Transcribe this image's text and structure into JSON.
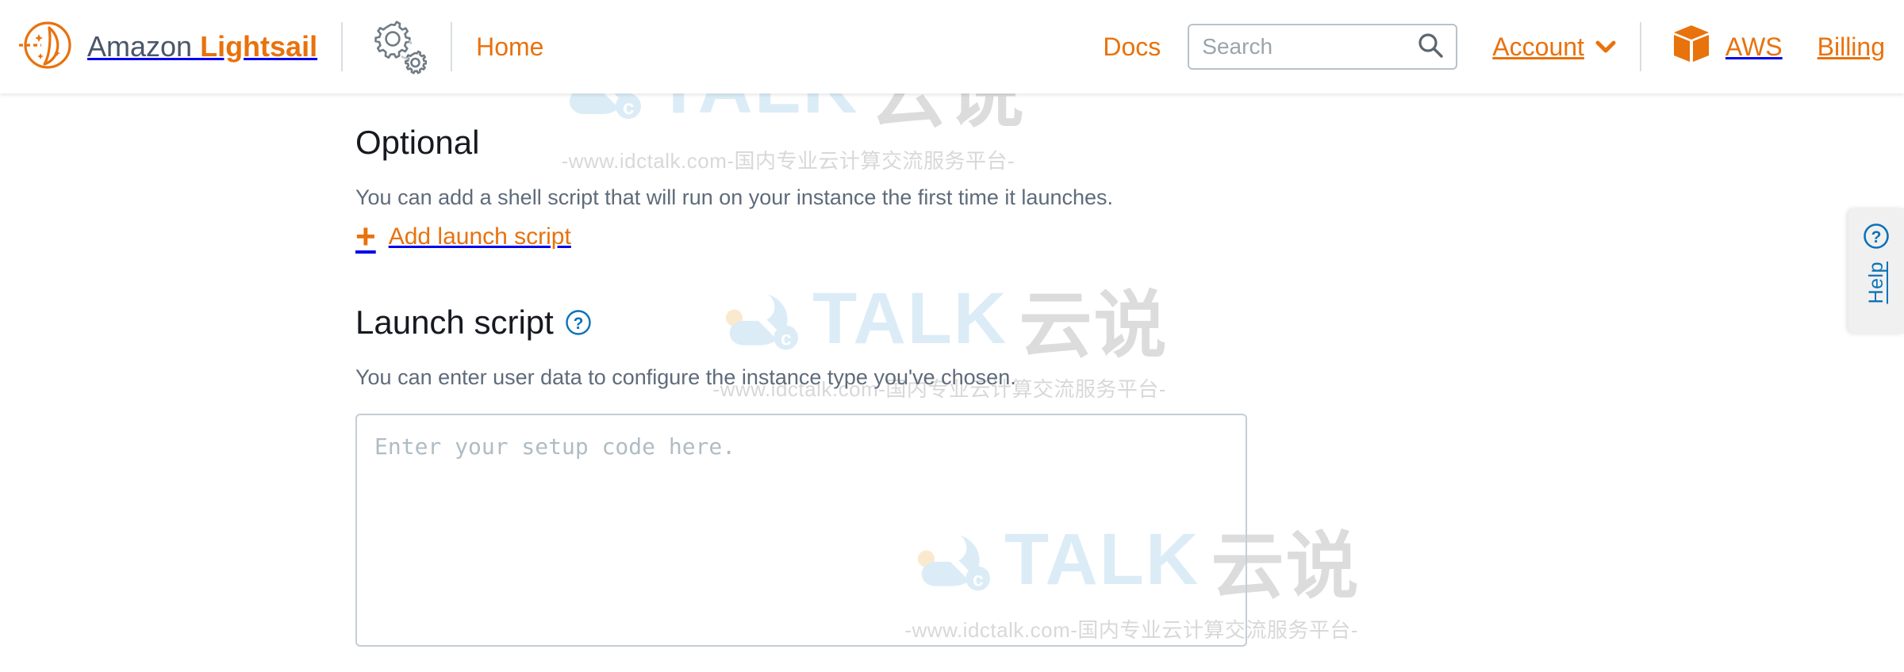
{
  "header": {
    "brand_prefix": "Amazon ",
    "brand_suffix": "Lightsail",
    "logo_icon": "lightsail-sail-icon",
    "gears_icon": "gears-icon",
    "home_label": "Home",
    "docs_label": "Docs",
    "search": {
      "placeholder": "Search",
      "value": "",
      "icon": "search-icon"
    },
    "account_label": "Account",
    "account_caret_icon": "chevron-down-icon",
    "aws_cube_icon": "aws-cube-icon",
    "aws_label": "AWS",
    "billing_label": "Billing",
    "accent_color": "#e8720c"
  },
  "main": {
    "optional_heading": "Optional",
    "optional_description": "You can add a shell script that will run on your instance the first time it launches.",
    "add_launch_script_label": "Add launch script",
    "add_icon": "plus-icon",
    "launch_script_heading": "Launch script",
    "launch_script_help_icon": "question-circle-icon",
    "launch_script_description": "You can enter user data to configure the instance type you've chosen.",
    "script_textarea": {
      "placeholder": "Enter your setup code here.",
      "value": ""
    }
  },
  "help_tab": {
    "icon": "question-circle-icon",
    "label": "Help",
    "color": "#0b72b9"
  },
  "watermarks": {
    "logo_text_c": "c",
    "logo_word": "TALK",
    "logo_cn": "云说",
    "subtitle": "-www.idctalk.com-国内专业云计算交流服务平台-"
  }
}
